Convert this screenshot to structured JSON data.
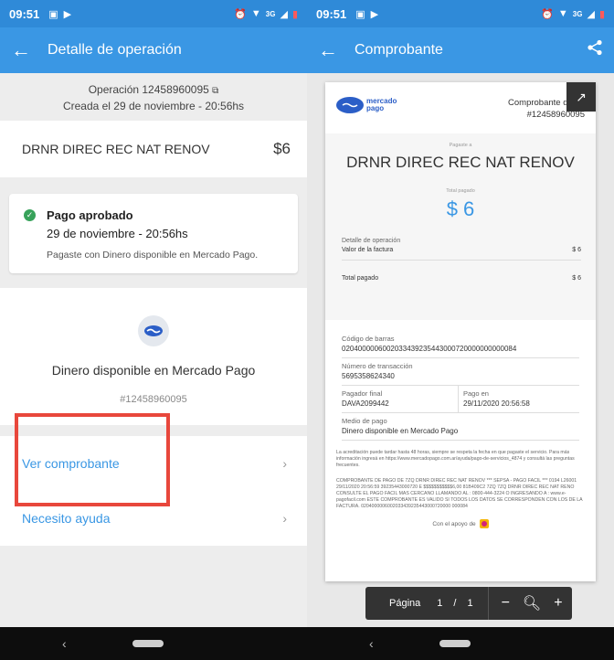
{
  "status_bar": {
    "time": "09:51",
    "network": "3G"
  },
  "left": {
    "appbar": {
      "title": "Detalle de operación"
    },
    "operation": {
      "line1": "Operación 12458960095",
      "line2": "Creada el 29 de noviembre - 20:56hs"
    },
    "merchant": {
      "name": "DRNR DIREC REC NAT RENOV",
      "amount": "$6"
    },
    "approved": {
      "title": "Pago aprobado",
      "date": "29 de noviembre - 20:56hs",
      "description": "Pagaste con Dinero disponible en Mercado Pago."
    },
    "method": {
      "name": "Dinero disponible en Mercado Pago",
      "id": "#12458960095"
    },
    "links": {
      "receipt": "Ver comprobante",
      "help": "Necesito ayuda"
    }
  },
  "right": {
    "appbar": {
      "title": "Comprobante"
    },
    "doc": {
      "logo_line1": "mercado",
      "logo_line2": "pago",
      "title": "Comprobante de pa",
      "number": "#12458960095",
      "paid_to_label": "Pagaste a",
      "merchant": "DRNR DIREC REC NAT RENOV",
      "total_label": "Total pagado",
      "total_amount": "$ 6",
      "detail_heading": "Detalle de operación",
      "invoice_label": "Valor de la factura",
      "invoice_value": "$ 6",
      "total_row_label": "Total pagado",
      "total_row_value": "$ 6",
      "barcode_label": "Código de barras",
      "barcode_value": "0204000006002033439235443000720000000000084",
      "transaction_label": "Número de transacción",
      "transaction_value": "5695358624340",
      "payer_label": "Pagador final",
      "payer_value": "DAVA2099442",
      "paid_on_label": "Pago en",
      "paid_on_value": "29/11/2020 20:56:58",
      "method_label": "Medio de pago",
      "method_value": "Dinero disponible en Mercado Pago",
      "fineprint1": "La acreditación puede tardar hasta 48 horas, siempre se respeta la fecha en que pagaste el servicio. Para más información ingresá en https://www.mercadopago.com.ar/ayuda/pago-de-servicios_4874 y consultá las preguntas frecuentes.",
      "fineprint2": "COMPROBANTE DE PAGO DE 7ZQ DRNR DIREC REC NAT RENOV *** SEPSA - PAGO FACIL *** 0194 L26001 29/11/2020 20:56:59 39235443000720 E $$$$$$$$$$$6,00 81B409C2 7ZQ 7ZQ DRNR DIREC REC NAT RENO CONSULTE EL PAGO FACIL MAS CERCANO LLAMANDO AL : 0800-444-3224 O INGRESANDO A : www.e-pagofacil.com ESTE COMPROBANTE ES VALIDO SI TODOS LOS DATOS SE CORRESPONDEN CON LOS DE LA FACTURA. 0204000006002033439235443000720000 000084",
      "support": "Con el apoyo de"
    },
    "pager": {
      "label": "Página",
      "current": "1",
      "sep": "/",
      "total": "1"
    }
  }
}
